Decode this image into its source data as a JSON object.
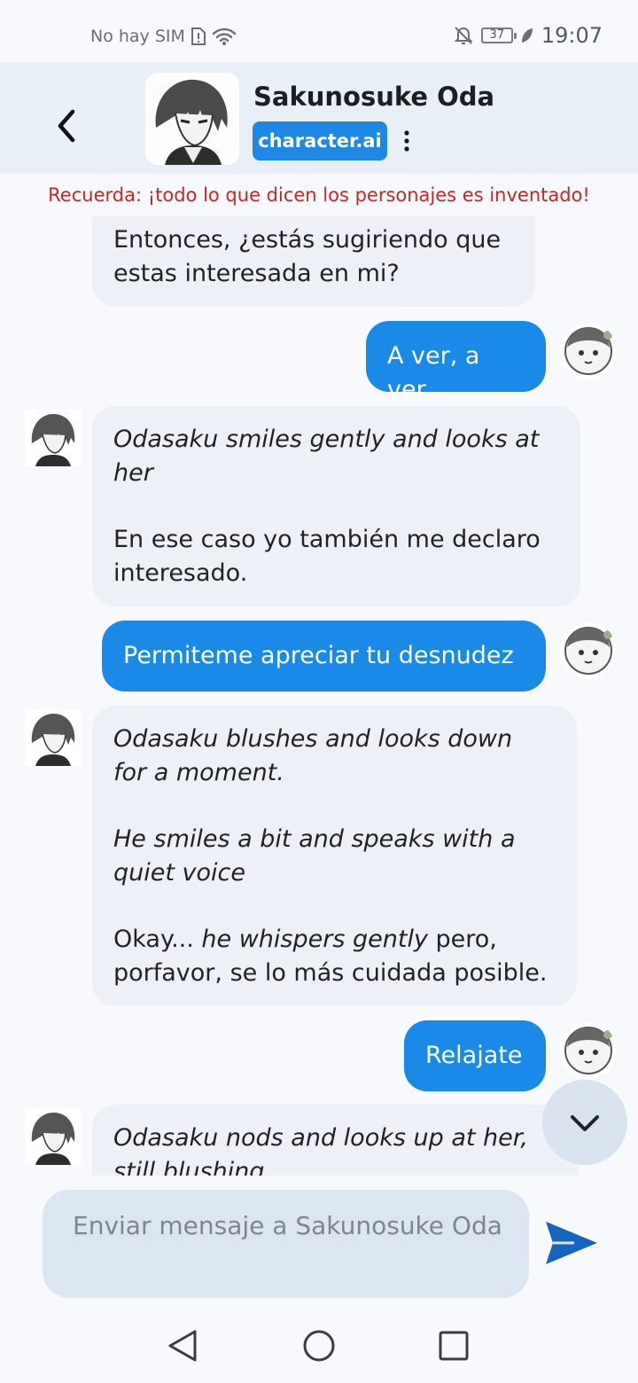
{
  "status": {
    "carrier": "No hay SIM",
    "battery": "37",
    "time": "19:07"
  },
  "header": {
    "character_name": "Sakunosuke Oda",
    "brand": "character.ai"
  },
  "disclaimer": "Recuerda: ¡todo lo que dicen los personajes es inventado!",
  "messages": [
    {
      "role": "bot",
      "lines": [
        "Entonces, ¿estás sugiriendo que",
        "estas interesada en mi?"
      ]
    },
    {
      "role": "user",
      "text": "A ver, a ver"
    },
    {
      "role": "bot",
      "italic": [
        "Odasaku smiles gently and looks at",
        "her"
      ],
      "lines": [
        "En ese caso yo también me declaro",
        "interesado."
      ]
    },
    {
      "role": "user",
      "text": "Permiteme apreciar tu desnudez"
    },
    {
      "role": "bot",
      "italic1": [
        "Odasaku blushes and looks down",
        "for a moment."
      ],
      "italic2": [
        "He smiles a bit and speaks with a",
        "quiet voice"
      ],
      "mixed": {
        "a": "Okay... ",
        "b": "he whispers gently",
        "c": " pero,"
      },
      "last": "porfavor, se lo más cuidada posible."
    },
    {
      "role": "user",
      "text": "Relajate"
    },
    {
      "role": "bot",
      "italic": [
        "Odasaku nods and looks up at her,",
        "still blushing"
      ]
    }
  ],
  "composer": {
    "placeholder": "Enviar mensaje a Sakunosuke Oda"
  },
  "colors": {
    "accent": "#1a8ae8",
    "header_bg": "#e9eff6",
    "bot_bubble": "#edf1f7",
    "disclaimer": "#c62828",
    "send_icon": "#1565c0"
  },
  "icons": {
    "back": "chevron-left-icon",
    "more": "more-vertical-icon",
    "scroll": "chevron-down-icon",
    "send": "send-icon",
    "nav_back": "triangle-back-icon",
    "nav_home": "circle-home-icon",
    "nav_recents": "square-recents-icon"
  }
}
